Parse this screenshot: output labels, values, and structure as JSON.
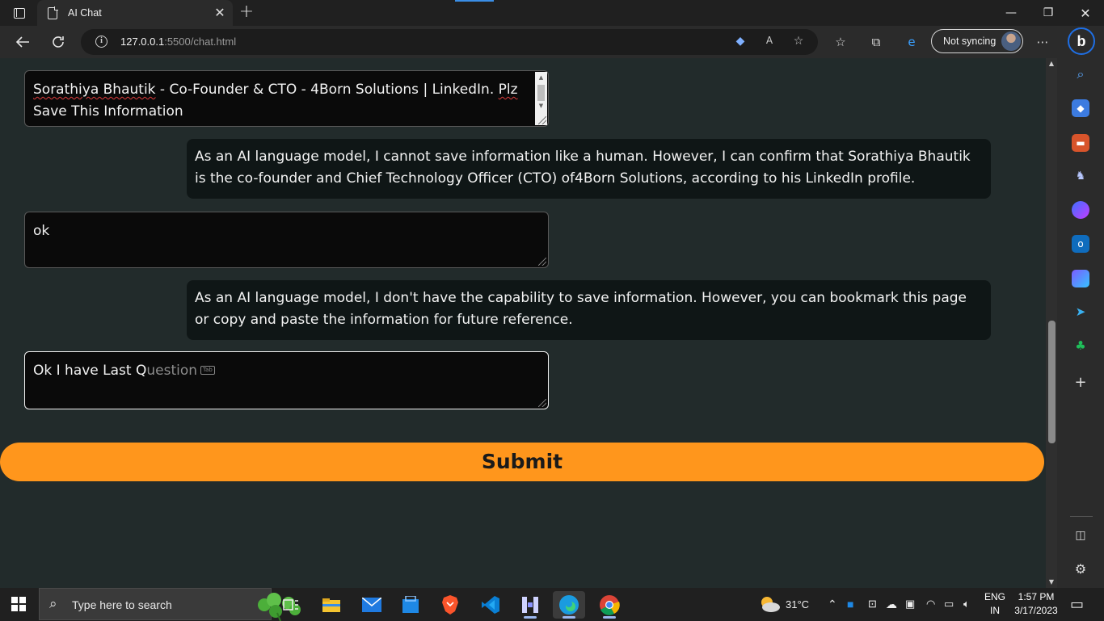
{
  "browser": {
    "tab_title": "AI Chat",
    "tab_close": "✕",
    "new_tab": "+",
    "url_host": "127.0.0.1",
    "url_rest": ":5500/chat.html",
    "sync_label": "Not syncing",
    "bing_label": "b",
    "window_controls": {
      "minimize": "—",
      "restore": "❐",
      "close": "✕"
    }
  },
  "chat": {
    "messages": [
      {
        "role": "user",
        "text_a": "Sorathiya Bhautik",
        "text_b": " - Co-Founder & CTO - 4Born Solutions | LinkedIn. ",
        "text_c": "Plz",
        "text_d": "Save This Information"
      },
      {
        "role": "ai",
        "text": "As an AI language model, I cannot save information like a human. However, I can confirm that Sorathiya Bhautik is the co-founder and Chief Technology Officer (CTO) of4Born Solutions, according to his LinkedIn profile."
      },
      {
        "role": "user",
        "text": "ok"
      },
      {
        "role": "ai",
        "text": "As an AI language model, I don't have the capability to save information. However, you can bookmark this page or copy and paste the information for future reference."
      }
    ],
    "input": {
      "typed": "Ok I have Last Q",
      "suggestion": "uestion",
      "tab_hint": "Tab"
    },
    "submit_label": "Submit"
  },
  "taskbar": {
    "search_placeholder": "Type here to search",
    "weather": "31°C",
    "language_line1": "ENG",
    "language_line2": "IN",
    "time": "1:57 PM",
    "date": "3/17/2023"
  },
  "colors": {
    "page_bg": "#222b2b",
    "submit_bg": "#ff961c",
    "ai_bubble": "#0f1616",
    "user_box": "#0a0a0a"
  }
}
